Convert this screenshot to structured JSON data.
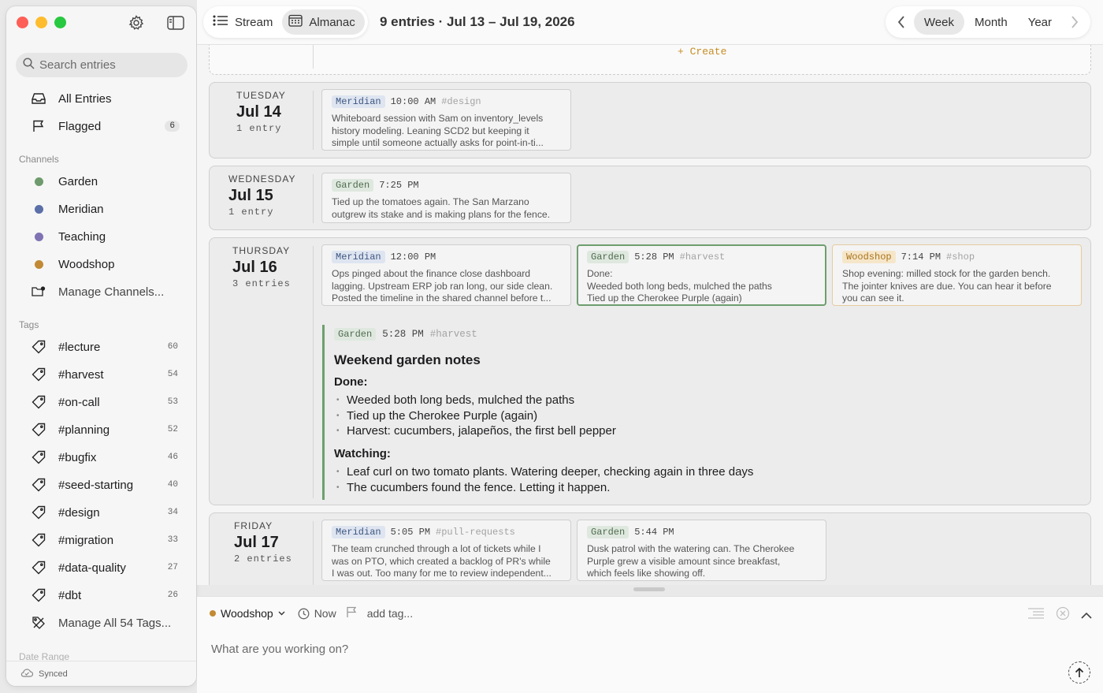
{
  "sidebar": {
    "search_placeholder": "Search entries",
    "nav": [
      {
        "label": "All Entries"
      },
      {
        "label": "Flagged",
        "badge": "6"
      }
    ],
    "channels_label": "Channels",
    "channels": [
      {
        "label": "Garden",
        "color": "#6e9a6e"
      },
      {
        "label": "Meridian",
        "color": "#5b6fa8"
      },
      {
        "label": "Teaching",
        "color": "#7f73b3"
      },
      {
        "label": "Woodshop",
        "color": "#c28a35"
      }
    ],
    "manage_channels": "Manage Channels...",
    "tags_label": "Tags",
    "tags": [
      {
        "label": "#lecture",
        "count": "60"
      },
      {
        "label": "#harvest",
        "count": "54"
      },
      {
        "label": "#on-call",
        "count": "53"
      },
      {
        "label": "#planning",
        "count": "52"
      },
      {
        "label": "#bugfix",
        "count": "46"
      },
      {
        "label": "#seed-starting",
        "count": "40"
      },
      {
        "label": "#design",
        "count": "34"
      },
      {
        "label": "#migration",
        "count": "33"
      },
      {
        "label": "#data-quality",
        "count": "27"
      },
      {
        "label": "#dbt",
        "count": "26"
      }
    ],
    "manage_tags": "Manage All 54 Tags...",
    "date_range_label": "Date Range",
    "sync_status": "Synced"
  },
  "toolbar": {
    "stream_label": "Stream",
    "almanac_label": "Almanac",
    "title": "9 entries · Jul 13 – Jul 19, 2026",
    "week": "Week",
    "month": "Month",
    "year": "Year"
  },
  "main": {
    "create_label": "+ Create",
    "days": [
      {
        "weekday": "TUESDAY",
        "date": "Jul 14",
        "count": "1 entry",
        "entries": [
          {
            "channel": "Meridian",
            "time": "10:00 AM",
            "tag": "#design",
            "lines": [
              "Whiteboard session with Sam on inventory_levels",
              "history modeling. Leaning SCD2 but keeping it",
              "simple until someone actually asks for point-in-ti..."
            ]
          }
        ]
      },
      {
        "weekday": "WEDNESDAY",
        "date": "Jul 15",
        "count": "1 entry",
        "entries": [
          {
            "channel": "Garden",
            "time": "7:25 PM",
            "tag": "",
            "lines": [
              "Tied up the tomatoes again. The San Marzano",
              "outgrew its stake and is making plans for the fence."
            ]
          }
        ]
      },
      {
        "weekday": "THURSDAY",
        "date": "Jul 16",
        "count": "3 entries",
        "entries": [
          {
            "channel": "Meridian",
            "time": "12:00 PM",
            "tag": "",
            "lines": [
              "Ops pinged about the finance close dashboard",
              "lagging. Upstream ERP job ran long, our side clean.",
              "Posted the timeline in the shared channel before t..."
            ]
          },
          {
            "channel": "Garden",
            "time": "5:28 PM",
            "tag": "#harvest",
            "lines": [
              "Done:",
              "Weeded both long beds, mulched the paths",
              "Tied up the Cherokee Purple (again)"
            ]
          },
          {
            "channel": "Woodshop",
            "time": "7:14 PM",
            "tag": "#shop",
            "lines": [
              "Shop evening: milled stock for the garden bench.",
              "The jointer knives are due. You can hear it before",
              "you can see it."
            ]
          }
        ],
        "expanded": {
          "channel": "Garden",
          "time": "5:28 PM",
          "tag": "#harvest",
          "title": "Weekend garden notes",
          "done_label": "Done:",
          "done": [
            "Weeded both long beds, mulched the paths",
            "Tied up the Cherokee Purple (again)",
            "Harvest: cucumbers, jalapeños, the first bell pepper"
          ],
          "watching_label": "Watching:",
          "watching": [
            "Leaf curl on two tomato plants. Watering deeper, checking again in three days",
            "The cucumbers found the fence. Letting it happen."
          ]
        }
      },
      {
        "weekday": "FRIDAY",
        "date": "Jul 17",
        "count": "2 entries",
        "entries": [
          {
            "channel": "Meridian",
            "time": "5:05 PM",
            "tag": "#pull-requests",
            "lines": [
              "The team crunched through a lot of tickets while I",
              "was on PTO, which created a backlog of PR's while",
              "I was out. Too many for me to review independent..."
            ]
          },
          {
            "channel": "Garden",
            "time": "5:44 PM",
            "tag": "",
            "lines": [
              "Dusk patrol with the watering can. The Cherokee",
              "Purple grew a visible amount since breakfast,",
              "which feels like showing off."
            ]
          }
        ]
      }
    ]
  },
  "composer": {
    "channel": "Woodshop",
    "channel_color": "#c28a35",
    "time_label": "Now",
    "tag_placeholder": "add tag...",
    "placeholder": "What are you working on?"
  }
}
